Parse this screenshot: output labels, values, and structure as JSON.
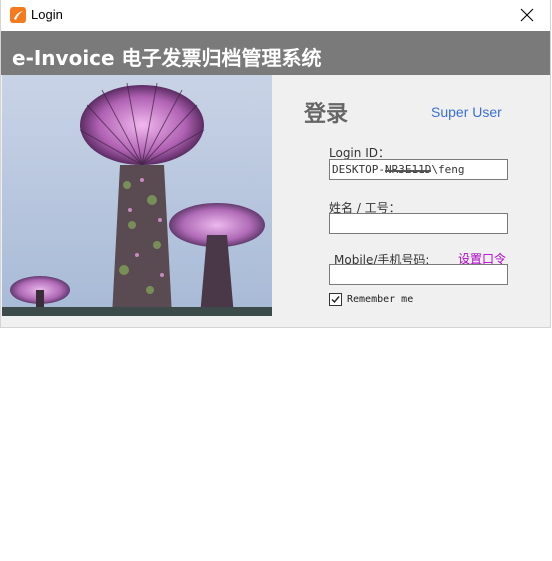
{
  "window": {
    "title": "Login",
    "close_symbol": "✕"
  },
  "banner": {
    "title": "e-Invoice 电子发票归档管理系统"
  },
  "form": {
    "heading": "登录",
    "super_user_link": "Super User",
    "login_id_label": "Login ID：",
    "login_id_prefix": "DESKTOP-",
    "login_id_masked": "NR3E11D",
    "login_id_suffix": "\\feng",
    "name_label": "姓名 / 工号：",
    "name_value": "",
    "mobile_label": "Mobile/手机号码:",
    "mobile_value": "",
    "reset_link": "设置口令",
    "remember_label": "Remember me",
    "remember_checked": true
  },
  "icons": {
    "app": "app-logo-icon",
    "close": "close-icon",
    "check": "checkmark-icon"
  },
  "colors": {
    "banner": "#7a7a7a",
    "app_icon": "#f47a20",
    "link_blue": "#3b6fd6",
    "link_purple": "#b000d0"
  }
}
